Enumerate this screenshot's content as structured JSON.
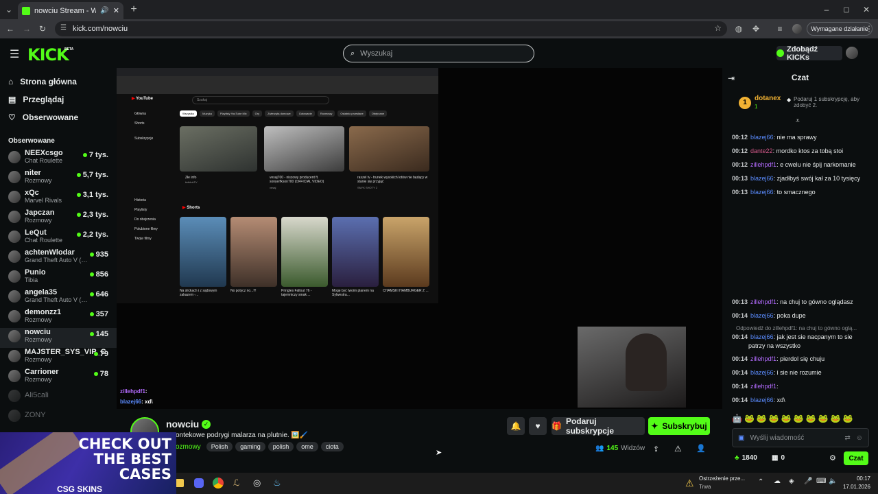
{
  "browser": {
    "tab_title": "nowciu Stream - Watch Live",
    "url": "kick.com/nowciu",
    "action_required": "Wymagane działanie"
  },
  "header": {
    "logo": "KICK",
    "logo_badge": "BETA",
    "search_placeholder": "Wyszukaj",
    "get_kicks": "Zdobądź KICKs"
  },
  "sidebar": {
    "nav": [
      "Strona główna",
      "Przeglądaj",
      "Obserwowane"
    ],
    "section_title": "Obserwowane",
    "channels": [
      {
        "name": "NEEXcsgo",
        "category": "Chat Roulette",
        "viewers": "7 tys."
      },
      {
        "name": "niter",
        "category": "Rozmowy",
        "viewers": "5,7 tys."
      },
      {
        "name": "xQc",
        "category": "Marvel Rivals",
        "viewers": "3,1 tys."
      },
      {
        "name": "Japczan",
        "category": "Rozmowy",
        "viewers": "2,3 tys."
      },
      {
        "name": "LeQut",
        "category": "Chat Roulette",
        "viewers": "2,2 tys."
      },
      {
        "name": "achtenWlodar",
        "category": "Grand Theft Auto V (G...",
        "viewers": "935"
      },
      {
        "name": "Punio",
        "category": "Tibia",
        "viewers": "856"
      },
      {
        "name": "angela35",
        "category": "Grand Theft Auto V (G...",
        "viewers": "646"
      },
      {
        "name": "demonzz1",
        "category": "Rozmowy",
        "viewers": "357"
      },
      {
        "name": "nowciu",
        "category": "Rozmowy",
        "viewers": "145"
      },
      {
        "name": "MAJSTER_SYS_VIP_C",
        "category": "Rozmowy",
        "viewers": "79"
      },
      {
        "name": "Carrioner",
        "category": "Rozmowy",
        "viewers": "78"
      }
    ],
    "offline": [
      "Ali5cali",
      "ZONY"
    ]
  },
  "video": {
    "overlay_chat": [
      {
        "user": "zillehpdf1",
        "text": ":"
      },
      {
        "user": "blazej66",
        "text": ": xd\\"
      }
    ],
    "yt": {
      "search": "Szukaj",
      "chips": [
        "Wszystko",
        "Muzyka",
        "Playlisty YouTube Mix",
        "Gry",
        "Zwierzęta domowe",
        "Gotowanie",
        "Rozmowy",
        "Ostatnio przesłane",
        "Obejrzane"
      ],
      "nav": [
        "Główna",
        "Shorts",
        "Subskrypcje",
        "Historia",
        "Playlisty",
        "Do obejrzenia",
        "Polubione filmy",
        "Twoje filmy"
      ],
      "shorts_label": "Shorts",
      "shorts": [
        "Na slickach i z sądowym zakazem -...",
        "No potycz no...!!!",
        "Pringles Fallout 76 - tajemniczy smak ...",
        "Mogę być twoim planem na Sylwestra...",
        "CHAMSKI HAMBURGER Z ..."
      ],
      "videos": [
        {
          "title": "Złe info",
          "channel": "bidklukTV"
        },
        {
          "title": "vesaj700 - niszowy producent ft. sonyerfkson700 (OFFICIAL VIDEO)",
          "channel": "vesaj"
        },
        {
          "title": "raszel tv - trunek wysokich lotów nie będący w stanie się przyjąć",
          "channel": "SNYK SHOTY 2"
        }
      ]
    }
  },
  "stream": {
    "channel": "nowciu",
    "title": "ontekowe podrygi malarza na plutnie. 🖼️🖌️",
    "category": "ozmowy",
    "tags": [
      "Polish",
      "gaming",
      "polish",
      "ome",
      "ciota"
    ],
    "gift_label": "Podaruj subskrypcje",
    "subscribe_label": "Subskrybuj",
    "viewers": "145",
    "viewers_label": "Widzów"
  },
  "chat": {
    "title": "Czat",
    "gifter": {
      "name": "dotanex",
      "rank": "1",
      "count": "1",
      "offer": "Podaruj 1 subskrypcję, aby zdobyć 2."
    },
    "messages_top": [
      {
        "time": "00:12",
        "user": "blazej66",
        "color": "#5b8cff",
        "text": ": nie ma sprawy"
      },
      {
        "time": "00:12",
        "user": "dante22",
        "color": "#d65a8c",
        "text": ": mordko ktos za tobą stoi"
      },
      {
        "time": "00:12",
        "user": "zillehpdf1",
        "color": "#b36bff",
        "text": ": e cwelu nie śpij narkomanie"
      },
      {
        "time": "00:13",
        "user": "blazej66",
        "color": "#5b8cff",
        "text": ": zjadłbyś swój kał za 10 tysięcy"
      },
      {
        "time": "00:13",
        "user": "blazej66",
        "color": "#5b8cff",
        "text": ": to smacznego"
      }
    ],
    "messages_bottom": [
      {
        "time": "00:13",
        "user": "zillehpdf1",
        "color": "#b36bff",
        "text": ": na chuj to gówno oglądasz"
      },
      {
        "time": "00:14",
        "user": "blazej66",
        "color": "#5b8cff",
        "text": ": poka dupe"
      },
      {
        "time": "00:14",
        "user": "blazej66",
        "color": "#5b8cff",
        "text": ": jak jest sie nacpanym to sie"
      },
      {
        "time": "00:14",
        "user": "zillehpdf1",
        "color": "#b36bff",
        "text": ": pierdol się chuju"
      },
      {
        "time": "00:14",
        "user": "blazej66",
        "color": "#5b8cff",
        "text": ": i sie nie rozumie"
      },
      {
        "time": "00:14",
        "user": "zillehpdf1",
        "color": "#b36bff",
        "text": ":"
      },
      {
        "time": "00:14",
        "user": "blazej66",
        "color": "#5b8cff",
        "text": ": xd\\"
      }
    ],
    "reply_note": "Odpowiedź do zillehpdf1: na chuj to gówno oglą...",
    "reply_cont": "patrzy na wszystko",
    "input_placeholder": "Wyślij wiadomość",
    "points": "1840",
    "gifts": "0",
    "send_label": "Czat"
  },
  "promo": {
    "line1": "CHECK OUT",
    "line2": "THE BEST",
    "line3": "CASES",
    "brand": "CSG SKINS"
  },
  "taskbar": {
    "warning_title": "Ostrzeżenie prze...",
    "warning_sub": "Trwa",
    "time": "00:17",
    "date": "17.01.2026"
  },
  "colors": {
    "kick_green": "#53fc18",
    "bg": "#0b0e0f"
  }
}
